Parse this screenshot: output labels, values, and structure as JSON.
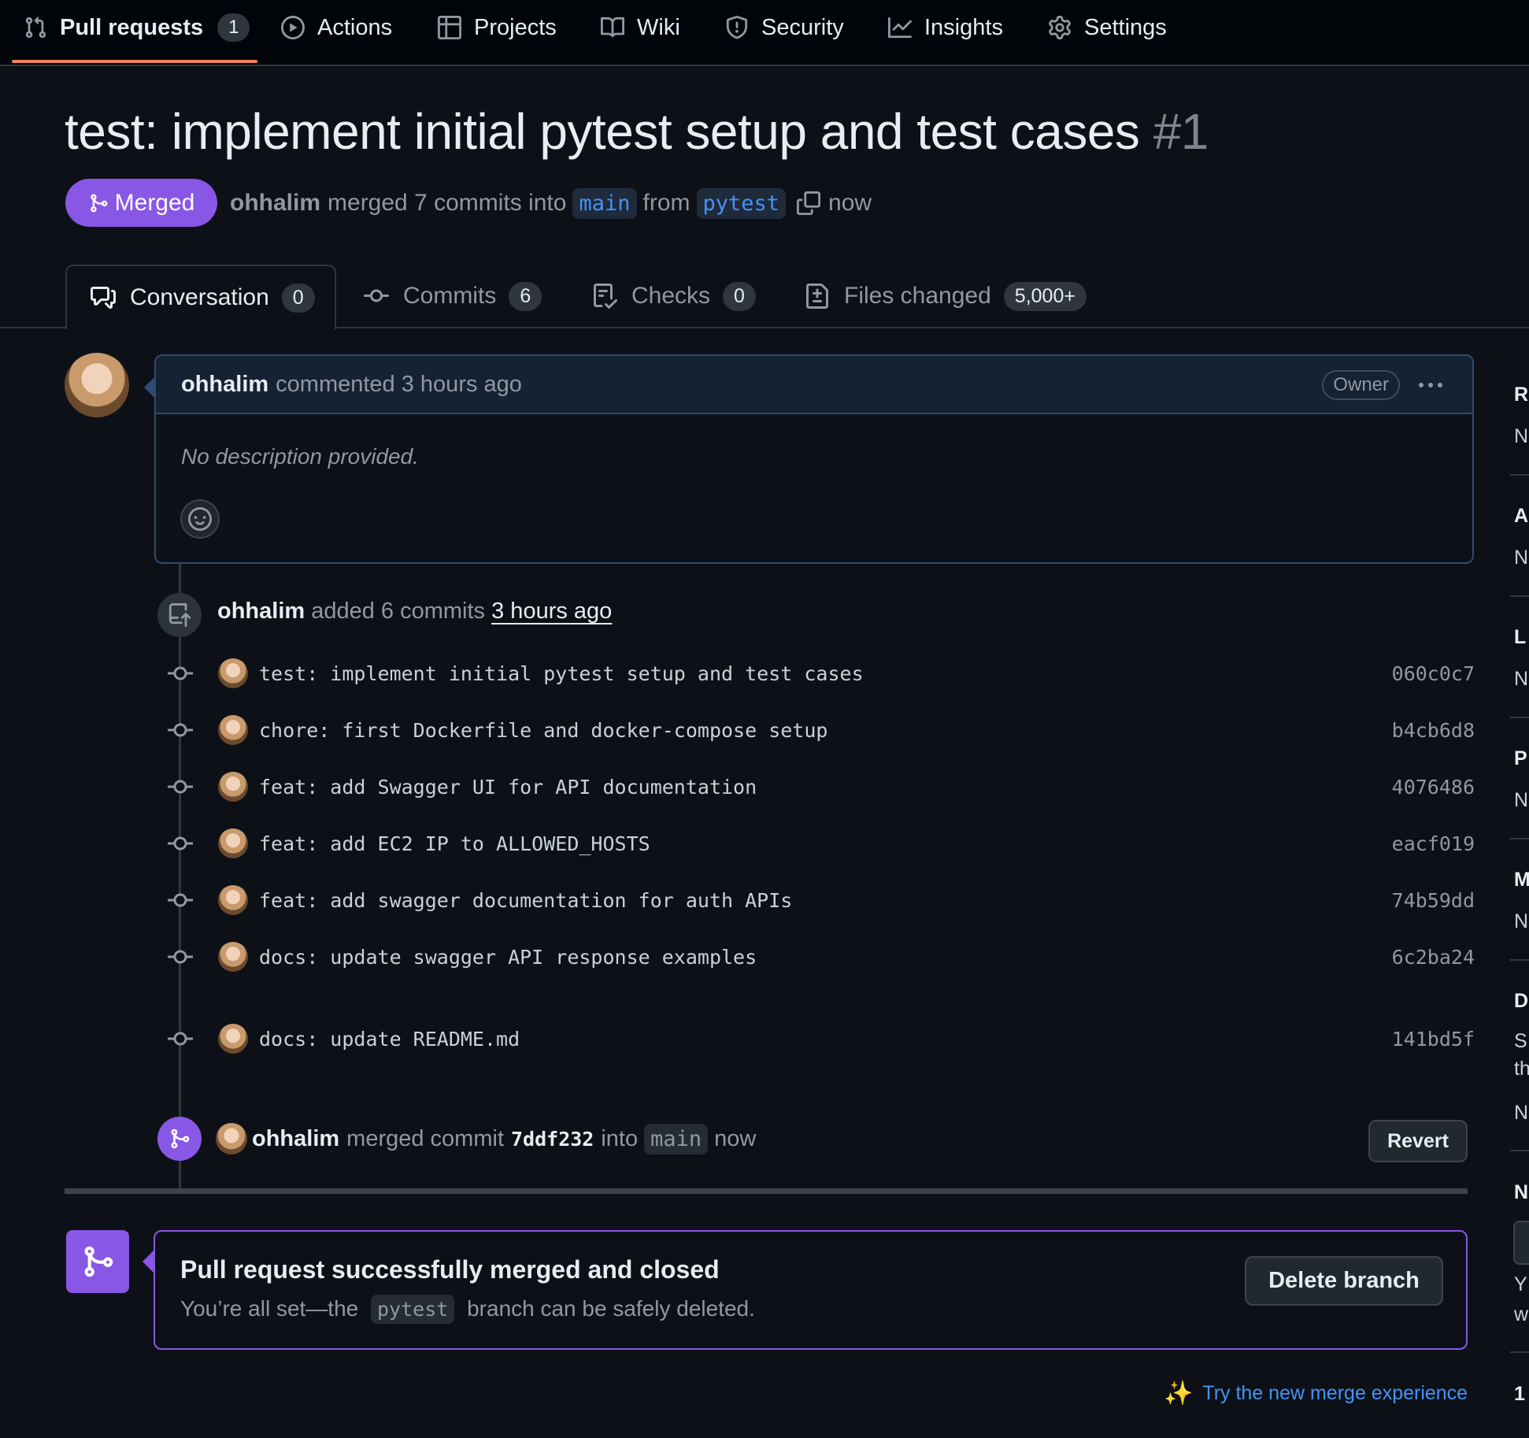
{
  "nav": {
    "items": [
      {
        "label": "Pull requests",
        "count": "1",
        "icon": "git-pull-request-icon"
      },
      {
        "label": "Actions",
        "icon": "play-icon"
      },
      {
        "label": "Projects",
        "icon": "table-icon"
      },
      {
        "label": "Wiki",
        "icon": "book-icon"
      },
      {
        "label": "Security",
        "icon": "shield-icon"
      },
      {
        "label": "Insights",
        "icon": "graph-icon"
      },
      {
        "label": "Settings",
        "icon": "gear-icon"
      }
    ],
    "active_color": "#f78166"
  },
  "pr": {
    "title": "test: implement initial pytest setup and test cases",
    "number": "#1",
    "state": "Merged",
    "state_color": "#8957e5",
    "author": "ohhalim",
    "summary": "merged 7 commits into",
    "base_branch": "main",
    "from_text": "from",
    "head_branch": "pytest",
    "time": "now"
  },
  "tabs": [
    {
      "label": "Conversation",
      "count": "0",
      "icon": "comment-discussion-icon"
    },
    {
      "label": "Commits",
      "count": "6",
      "icon": "git-commit-icon"
    },
    {
      "label": "Checks",
      "count": "0",
      "icon": "checklist-icon"
    },
    {
      "label": "Files changed",
      "count": "5,000+",
      "icon": "file-diff-icon"
    }
  ],
  "comment": {
    "author": "ohhalim",
    "action": "commented 3 hours ago",
    "badge": "Owner",
    "body": "No description provided."
  },
  "push_event": {
    "author": "ohhalim",
    "action": "added 6 commits",
    "time": "3 hours ago"
  },
  "commits": [
    {
      "message": "test: implement initial pytest setup and test cases",
      "sha": "060c0c7"
    },
    {
      "message": "chore: first Dockerfile and docker-compose setup",
      "sha": "b4cb6d8"
    },
    {
      "message": "feat: add Swagger UI for API documentation",
      "sha": "4076486"
    },
    {
      "message": "feat: add EC2 IP to ALLOWED_HOSTS",
      "sha": "eacf019"
    },
    {
      "message": "feat: add swagger documentation for auth APIs",
      "sha": "74b59dd"
    },
    {
      "message": "docs: update swagger API response examples",
      "sha": "6c2ba24"
    },
    {
      "message": "docs: update README.md",
      "sha": "141bd5f"
    }
  ],
  "merge_event": {
    "author": "ohhalim",
    "action": "merged commit",
    "sha": "7ddf232",
    "into": "into",
    "branch": "main",
    "time": "now",
    "revert_label": "Revert"
  },
  "merge_box": {
    "title": "Pull request successfully merged and closed",
    "sub_before": "You’re all set—the",
    "branch": "pytest",
    "sub_after": "branch can be safely deleted.",
    "delete_label": "Delete branch"
  },
  "try_merge": {
    "label": "Try the new merge experience"
  },
  "sidebar_fragments": {
    "items": [
      "R",
      "N",
      "A",
      "N",
      "L",
      "N",
      "P",
      "N",
      "M",
      "N",
      "D",
      "S",
      "th",
      "N",
      "N",
      "Y",
      "w",
      "1"
    ]
  }
}
